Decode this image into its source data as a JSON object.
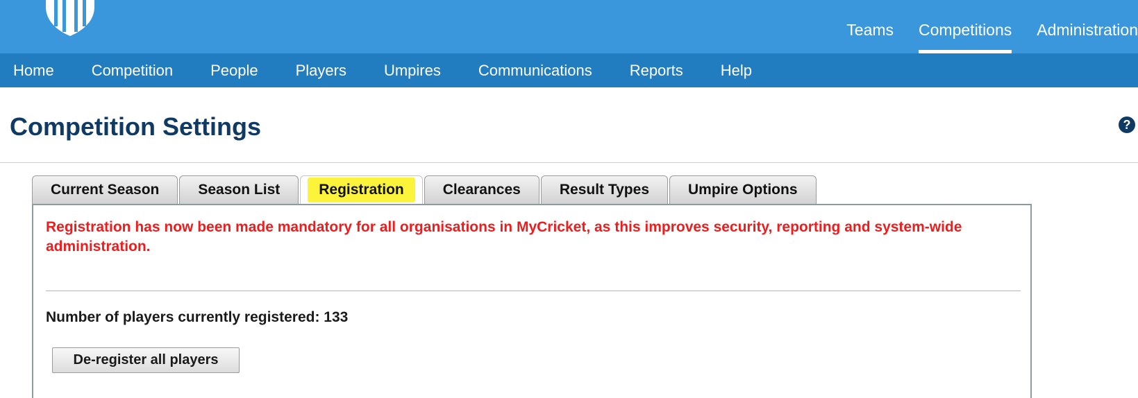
{
  "top_nav": {
    "items": [
      {
        "label": "Teams",
        "active": false
      },
      {
        "label": "Competitions",
        "active": true
      },
      {
        "label": "Administration",
        "active": false
      }
    ]
  },
  "sub_nav": {
    "items": [
      "Home",
      "Competition",
      "People",
      "Players",
      "Umpires",
      "Communications",
      "Reports",
      "Help"
    ]
  },
  "header": {
    "title": "Competition Settings",
    "help_icon": "question-circle-icon"
  },
  "tabs": [
    {
      "label": "Current Season",
      "active": false
    },
    {
      "label": "Season List",
      "active": false
    },
    {
      "label": "Registration",
      "active": true
    },
    {
      "label": "Clearances",
      "active": false
    },
    {
      "label": "Result Types",
      "active": false
    },
    {
      "label": "Umpire Options",
      "active": false
    }
  ],
  "registration": {
    "warning": "Registration has now been made mandatory for all organisations in MyCricket, as this improves security, reporting and system-wide administration.",
    "count_text": "Number of players currently registered: 133",
    "deregister_button": "De-register all players"
  },
  "colors": {
    "banner": "#3a97db",
    "subnav": "#217dc0",
    "title": "#0f3a63",
    "warning": "#ee1c1c",
    "highlight": "#fbf43a"
  }
}
